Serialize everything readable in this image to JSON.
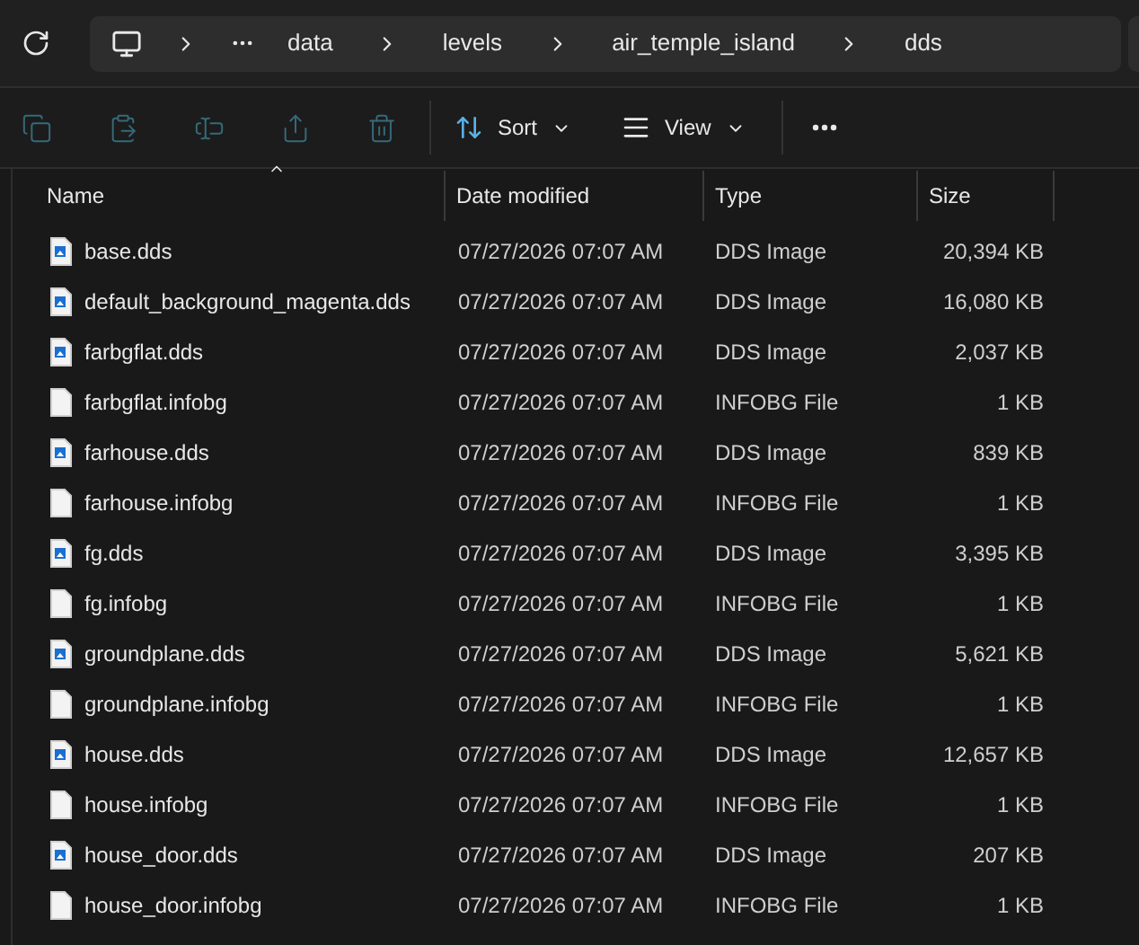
{
  "address_bar": {
    "crumbs": [
      "data",
      "levels",
      "air_temple_island",
      "dds"
    ]
  },
  "toolbar": {
    "actions": [
      {
        "kind": "copy",
        "disabled": true
      },
      {
        "kind": "paste",
        "disabled": true
      },
      {
        "kind": "rename",
        "disabled": true
      },
      {
        "kind": "share",
        "disabled": true
      },
      {
        "kind": "delete",
        "disabled": true
      }
    ],
    "sort": {
      "label": "Sort"
    },
    "view": {
      "label": "View"
    }
  },
  "table": {
    "columns": [
      {
        "label": "Name",
        "sorted": true
      },
      {
        "label": "Date modified",
        "sorted": false
      },
      {
        "label": "Type",
        "sorted": false
      },
      {
        "label": "Size",
        "sorted": false
      }
    ],
    "rows": [
      {
        "kind": "image",
        "name": "base.dds",
        "date": "07/27/2026 07:07 AM",
        "type": "DDS Image",
        "size": "20,394 KB"
      },
      {
        "kind": "image",
        "name": "default_background_magenta.dds",
        "date": "07/27/2026 07:07 AM",
        "type": "DDS Image",
        "size": "16,080 KB"
      },
      {
        "kind": "image",
        "name": "farbgflat.dds",
        "date": "07/27/2026 07:07 AM",
        "type": "DDS Image",
        "size": "2,037 KB"
      },
      {
        "kind": "file",
        "name": "farbgflat.infobg",
        "date": "07/27/2026 07:07 AM",
        "type": "INFOBG File",
        "size": "1 KB"
      },
      {
        "kind": "image",
        "name": "farhouse.dds",
        "date": "07/27/2026 07:07 AM",
        "type": "DDS Image",
        "size": "839 KB"
      },
      {
        "kind": "file",
        "name": "farhouse.infobg",
        "date": "07/27/2026 07:07 AM",
        "type": "INFOBG File",
        "size": "1 KB"
      },
      {
        "kind": "image",
        "name": "fg.dds",
        "date": "07/27/2026 07:07 AM",
        "type": "DDS Image",
        "size": "3,395 KB"
      },
      {
        "kind": "file",
        "name": "fg.infobg",
        "date": "07/27/2026 07:07 AM",
        "type": "INFOBG File",
        "size": "1 KB"
      },
      {
        "kind": "image",
        "name": "groundplane.dds",
        "date": "07/27/2026 07:07 AM",
        "type": "DDS Image",
        "size": "5,621 KB"
      },
      {
        "kind": "file",
        "name": "groundplane.infobg",
        "date": "07/27/2026 07:07 AM",
        "type": "INFOBG File",
        "size": "1 KB"
      },
      {
        "kind": "image",
        "name": "house.dds",
        "date": "07/27/2026 07:07 AM",
        "type": "DDS Image",
        "size": "12,657 KB"
      },
      {
        "kind": "file",
        "name": "house.infobg",
        "date": "07/27/2026 07:07 AM",
        "type": "INFOBG File",
        "size": "1 KB"
      },
      {
        "kind": "image",
        "name": "house_door.dds",
        "date": "07/27/2026 07:07 AM",
        "type": "DDS Image",
        "size": "207 KB"
      },
      {
        "kind": "file",
        "name": "house_door.infobg",
        "date": "07/27/2026 07:07 AM",
        "type": "INFOBG File",
        "size": "1 KB"
      }
    ]
  }
}
